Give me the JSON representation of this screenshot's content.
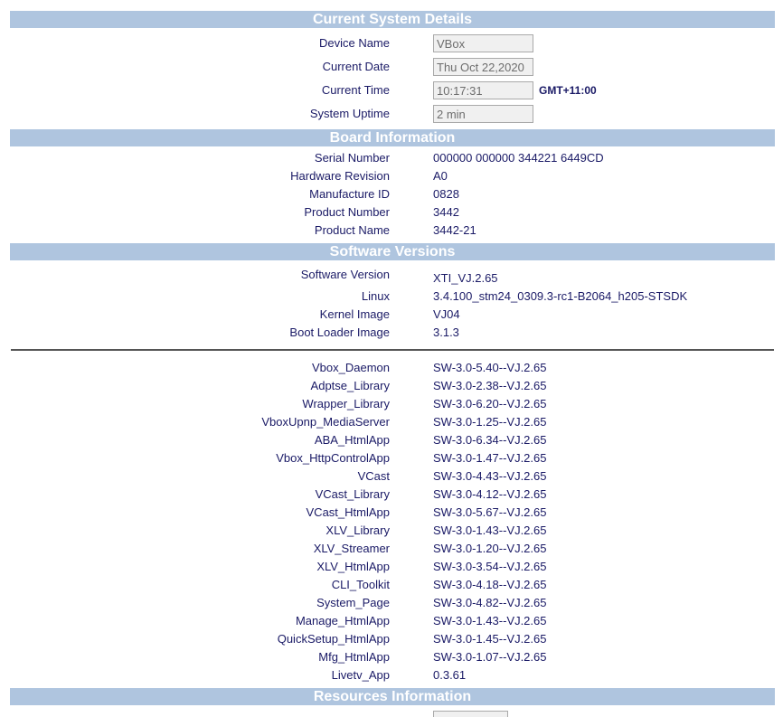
{
  "current_system": {
    "title": "Current System Details",
    "device_name": {
      "label": "Device Name",
      "value": "VBox"
    },
    "current_date": {
      "label": "Current Date",
      "value": "Thu Oct 22,2020"
    },
    "current_time": {
      "label": "Current Time",
      "value": "10:17:31",
      "timezone": "GMT+11:00"
    },
    "system_uptime": {
      "label": "System Uptime",
      "value": "2 min"
    }
  },
  "board": {
    "title": "Board Information",
    "rows": [
      {
        "label": "Serial Number",
        "value": "000000 000000 344221 6449CD"
      },
      {
        "label": "Hardware Revision",
        "value": "A0"
      },
      {
        "label": "Manufacture ID",
        "value": "0828"
      },
      {
        "label": "Product Number",
        "value": "3442"
      },
      {
        "label": "Product Name",
        "value": "3442-21"
      }
    ]
  },
  "software": {
    "title": "Software Versions",
    "rows": [
      {
        "label": "Software Version",
        "value": "XTI_VJ.2.65"
      },
      {
        "label": "Linux",
        "value": "3.4.100_stm24_0309.3-rc1-B2064_h205-STSDK"
      },
      {
        "label": "Kernel Image",
        "value": "VJ04"
      },
      {
        "label": "Boot Loader Image",
        "value": "3.1.3"
      }
    ],
    "components": [
      {
        "label": "Vbox_Daemon",
        "value": "SW-3.0-5.40--VJ.2.65"
      },
      {
        "label": "Adptse_Library",
        "value": "SW-3.0-2.38--VJ.2.65"
      },
      {
        "label": "Wrapper_Library",
        "value": "SW-3.0-6.20--VJ.2.65"
      },
      {
        "label": "VboxUpnp_MediaServer",
        "value": "SW-3.0-1.25--VJ.2.65"
      },
      {
        "label": "ABA_HtmlApp",
        "value": "SW-3.0-6.34--VJ.2.65"
      },
      {
        "label": "Vbox_HttpControlApp",
        "value": "SW-3.0-1.47--VJ.2.65"
      },
      {
        "label": "VCast",
        "value": "SW-3.0-4.43--VJ.2.65"
      },
      {
        "label": "VCast_Library",
        "value": "SW-3.0-4.12--VJ.2.65"
      },
      {
        "label": "VCast_HtmlApp",
        "value": "SW-3.0-5.67--VJ.2.65"
      },
      {
        "label": "XLV_Library",
        "value": "SW-3.0-1.43--VJ.2.65"
      },
      {
        "label": "XLV_Streamer",
        "value": "SW-3.0-1.20--VJ.2.65"
      },
      {
        "label": "XLV_HtmlApp",
        "value": "SW-3.0-3.54--VJ.2.65"
      },
      {
        "label": "CLI_Toolkit",
        "value": "SW-3.0-4.18--VJ.2.65"
      },
      {
        "label": "System_Page",
        "value": "SW-3.0-4.82--VJ.2.65"
      },
      {
        "label": "Manage_HtmlApp",
        "value": "SW-3.0-1.43--VJ.2.65"
      },
      {
        "label": "QuickSetup_HtmlApp",
        "value": "SW-3.0-1.45--VJ.2.65"
      },
      {
        "label": "Mfg_HtmlApp",
        "value": "SW-3.0-1.07--VJ.2.65"
      },
      {
        "label": "Livetv_App",
        "value": "0.3.61"
      }
    ]
  },
  "resources": {
    "title": "Resources Information"
  }
}
